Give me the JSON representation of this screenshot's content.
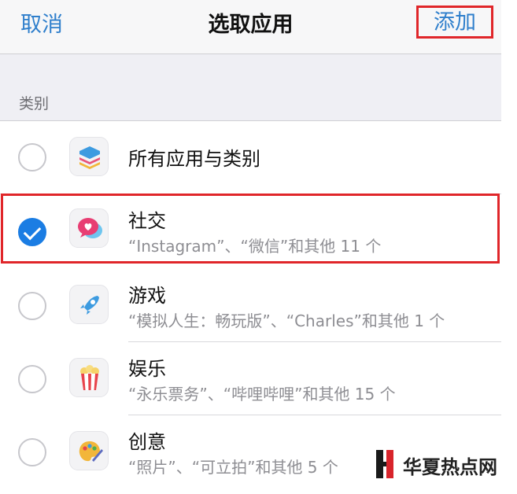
{
  "navbar": {
    "cancel_label": "取消",
    "title": "选取应用",
    "add_label": "添加"
  },
  "section": {
    "label": "类别"
  },
  "rows": [
    {
      "title": "所有应用与类别",
      "subtitle": "",
      "checked": false,
      "icon": "stack-layers-icon"
    },
    {
      "title": "社交",
      "subtitle": "“Instagram”、“微信”和其他 11 个",
      "checked": true,
      "icon": "social-chat-heart-icon"
    },
    {
      "title": "游戏",
      "subtitle": "“模拟人生：畅玩版”、“Charles”和其他 1 个",
      "checked": false,
      "icon": "rocket-icon"
    },
    {
      "title": "娱乐",
      "subtitle": "“永乐票务”、“哔哩哔哩”和其他 15 个",
      "checked": false,
      "icon": "popcorn-icon"
    },
    {
      "title": "创意",
      "subtitle": "“照片”、“可立拍”和其他 5 个",
      "checked": false,
      "icon": "palette-icon"
    }
  ],
  "watermark": {
    "text": "华夏热点网"
  },
  "colors": {
    "accent_blue": "#2f7fcc",
    "check_blue": "#1b7de3",
    "highlight_red": "#e0262a"
  }
}
